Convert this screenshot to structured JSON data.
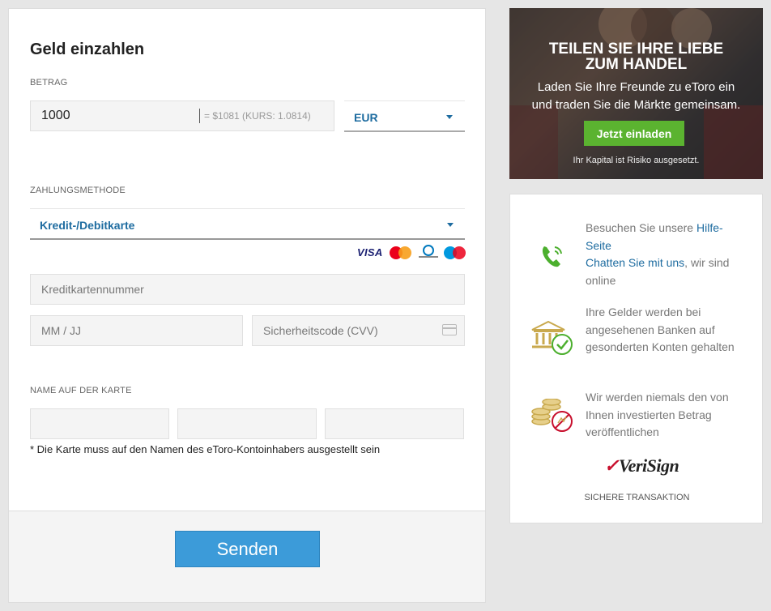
{
  "form": {
    "title": "Geld einzahlen",
    "amount_label": "BETRAG",
    "amount_value": "1000",
    "amount_conversion": "= $1081   (KURS: 1.0814)",
    "currency": "EUR",
    "payment_method_label": "ZAHLUNGSMETHODE",
    "payment_method": "Kredit-/Debitkarte",
    "card_logos": [
      "VISA",
      "MasterCard",
      "Diners Club International",
      "Maestro"
    ],
    "card_number_placeholder": "Kreditkartennummer",
    "expiry_placeholder": "MM / JJ",
    "cvv_placeholder": "Sicherheitscode (CVV)",
    "name_label": "NAME AUF DER KARTE",
    "name_note": "* Die Karte muss auf den Namen des eToro-Kontoinhabers ausgestellt sein",
    "submit_label": "Senden"
  },
  "banner": {
    "title": "TEILEN SIE IHRE LIEBE\nZUM HANDEL",
    "subtitle": "Laden Sie Ihre Freunde zu eToro ein\nund traden Sie die Märkte gemeinsam.",
    "button_label": "Jetzt einladen",
    "risk_note": "Ihr Kapital ist Risiko ausgesetzt."
  },
  "trust": {
    "support_text_1": "Besuchen Sie unsere ",
    "support_link_1": "Hilfe-Seite",
    "support_link_2": "Chatten Sie mit uns",
    "support_text_2": ", wir sind online",
    "banks_text": "Ihre Gelder werden bei angesehenen Banken auf gesonderten Konten gehalten",
    "privacy_text": "Wir werden niemals den von Ihnen investierten Betrag veröffentlichen",
    "verisign_logo": "VeriSign",
    "secure_label": "SICHERE TRANSAKTION"
  },
  "colors": {
    "link_blue": "#1e6ca0",
    "submit_blue": "#3c9bd9",
    "invite_green": "#5bb330",
    "icon_green": "#4caf2e",
    "icon_gold": "#c9a94e"
  },
  "icons": [
    "phone-icon",
    "bank-check-icon",
    "coins-privacy-icon",
    "verisign-logo",
    "cvv-card-icon",
    "chevron-down-icon"
  ]
}
